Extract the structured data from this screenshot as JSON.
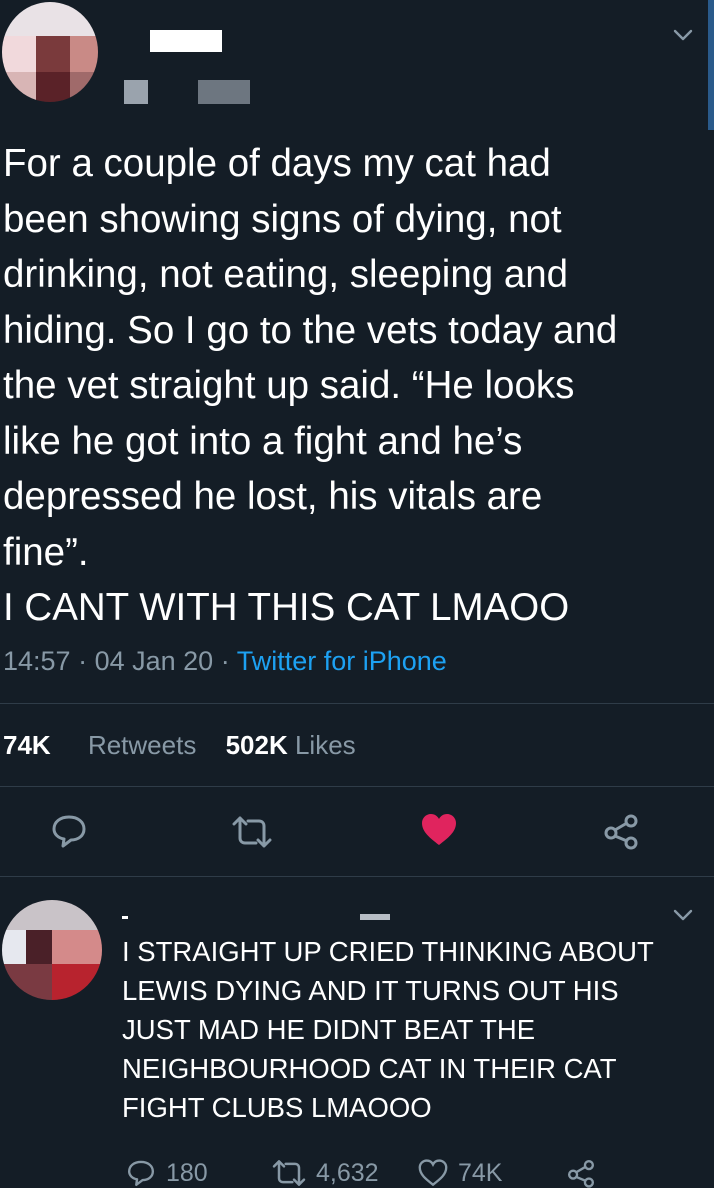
{
  "tweet": {
    "text": "For a couple of days my cat had\nbeen showing signs of dying, not\ndrinking, not eating, sleeping and\nhiding. So I go to the vets today and\nthe vet straight up said. “He looks\nlike he got into a fight and he’s\ndepressed he lost, his vitals are\nfine”.\nI CANT WITH THIS CAT LMAOO",
    "time": "14:57",
    "date": "04 Jan 20",
    "source": "Twitter for iPhone",
    "retweets_count": "74K",
    "retweets_label": "Retweets",
    "likes_count": "502K",
    "likes_label": "Likes"
  },
  "reply": {
    "text": "I STRAIGHT UP CRIED THINKING ABOUT\nLEWIS DYING AND IT TURNS OUT HIS\nJUST MAD HE DIDNT BEAT THE\nNEIGHBOURHOOD CAT IN THEIR CAT\nFIGHT CLUBS LMAOOO",
    "replies": "180",
    "retweets": "4,632",
    "likes": "74K"
  },
  "colors": {
    "background": "#141d26",
    "muted": "#8899a6",
    "link": "#1da1f2",
    "like": "#e0245e",
    "divider": "#2f3c48"
  },
  "icons": {
    "reply": "reply-icon",
    "retweet": "retweet-icon",
    "like": "heart-icon",
    "share": "share-icon",
    "more": "chevron-down-icon"
  }
}
